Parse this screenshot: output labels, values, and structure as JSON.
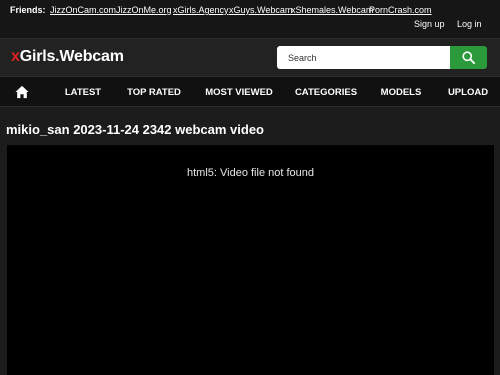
{
  "friends": {
    "label": "Friends:",
    "links": [
      "JizzOnCam.com",
      "JizzOnMe.org",
      "xGirls.Agency",
      "xGuys.Webcam",
      "xShemales.Webcam",
      "PornCrash.com"
    ]
  },
  "auth": {
    "signup": "Sign up",
    "login": "Log in"
  },
  "logo": {
    "accent": "x",
    "rest": "Girls.Webcam"
  },
  "search": {
    "placeholder": "Search",
    "icon": "search-icon"
  },
  "nav": {
    "home_icon": "home-icon",
    "items": [
      "LATEST",
      "TOP RATED",
      "MOST VIEWED",
      "CATEGORIES",
      "MODELS",
      "UPLOAD"
    ]
  },
  "video": {
    "title": "mikio_san 2023-11-24 2342 webcam video",
    "player_message": "html5: Video file not found"
  },
  "colors": {
    "accent_red": "#e02020",
    "search_green": "#2b9a3a",
    "background": "#1c1c1c"
  }
}
